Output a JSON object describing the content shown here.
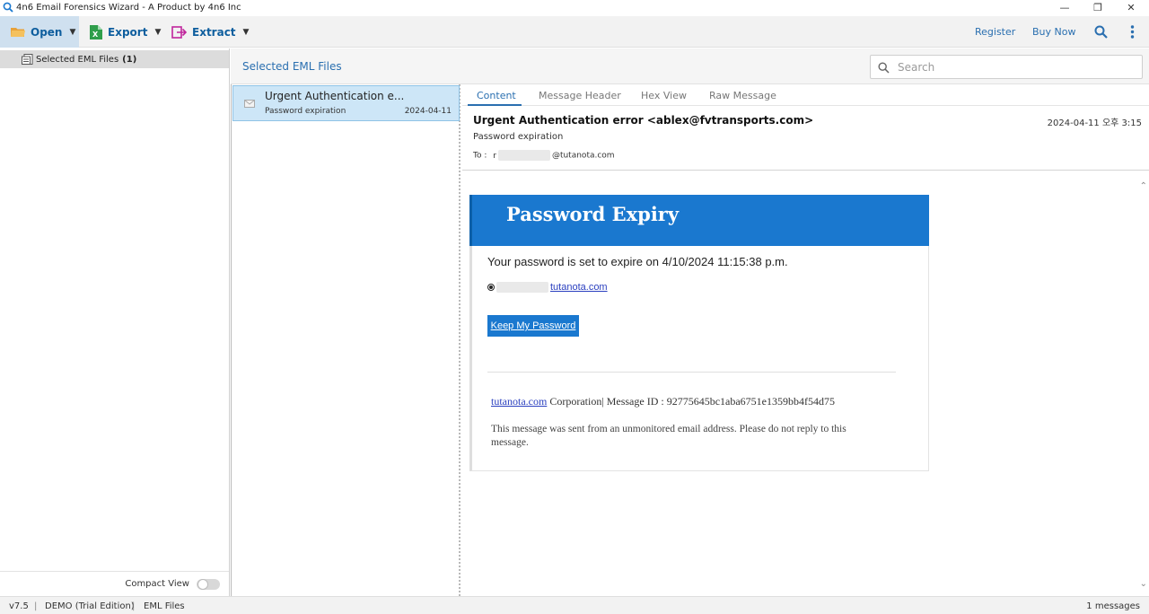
{
  "window": {
    "title": "4n6 Email Forensics Wizard - A Product by 4n6 Inc",
    "min_glyph": "—",
    "restore_glyph": "❐",
    "close_glyph": "✕"
  },
  "toolbar": {
    "open_label": "Open",
    "export_label": "Export",
    "extract_label": "Extract",
    "register_label": "Register",
    "buy_now_label": "Buy Now",
    "caret": "▼"
  },
  "tree": {
    "item_label": "Selected EML Files",
    "item_count": "(1)"
  },
  "list": {
    "header_title": "Selected EML Files",
    "items": [
      {
        "subject": "Urgent Authentication e...",
        "snippet": "Password expiration",
        "date": "2024-04-11"
      }
    ]
  },
  "search": {
    "placeholder": "Search"
  },
  "compact_view_label": "Compact View",
  "preview": {
    "tabs": [
      "Content",
      "Message Header",
      "Hex View",
      "Raw Message"
    ],
    "subject": "Urgent Authentication error <ablex@fvtransports.com>",
    "date": "2024-04-11 오후 3:15",
    "snippet": "Password expiration",
    "to_label": "To :",
    "to_initial": "r",
    "to_domain": "@tutanota.com"
  },
  "email": {
    "banner_title": "Password Expiry",
    "body_text": "Your password is set to expire on 4/10/2024 11:15:38 p.m.",
    "account_link": "tutanota.com",
    "keep_button": "Keep My Password",
    "footer_link": "tutanota.com",
    "footer_text": " Corporation| Message ID : 92775645bc1aba6751e1359bb4f54d75",
    "disclaimer": "This message was sent from an unmonitored email address. Please do not reply to this message."
  },
  "status": {
    "version": "v7.5",
    "edition": "DEMO (Trial Edition)",
    "file_type": "EML Files",
    "separator": "|",
    "message_count": "1 messages"
  },
  "colors": {
    "accent": "#2a6fb0",
    "banner_blue": "#1a78cf",
    "selected_row": "#cde6f7"
  }
}
